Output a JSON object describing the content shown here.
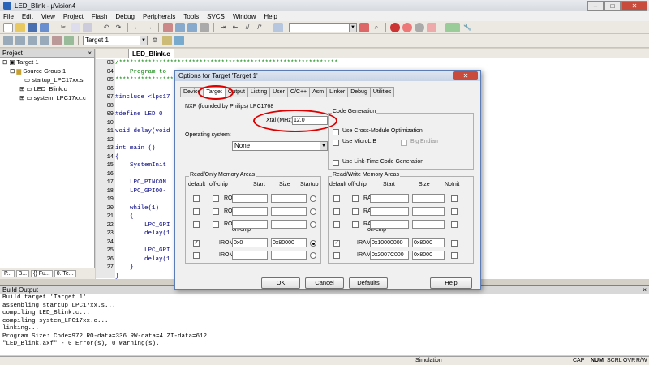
{
  "window": {
    "title": "LED_Blink - µVision4",
    "min": "–",
    "max": "□",
    "close": "✕"
  },
  "menu": [
    "File",
    "Edit",
    "View",
    "Project",
    "Flash",
    "Debug",
    "Peripherals",
    "Tools",
    "SVCS",
    "Window",
    "Help"
  ],
  "toolbar": {
    "target_select": "Target 1"
  },
  "project": {
    "header": "Project",
    "tree": [
      "Target 1",
      "Source Group 1",
      "startup_LPC17xx.s",
      "LED_Blink.c",
      "system_LPC17xx.c"
    ],
    "tabs": [
      "P...",
      "B...",
      "{} Fu...",
      "0. Te..."
    ]
  },
  "editor": {
    "tab": "LED_Blink.c",
    "line_numbers": [
      "03",
      "04",
      "05",
      "06",
      "07",
      "08",
      "09",
      "10",
      "11",
      "12",
      "13",
      "14",
      "15",
      "16",
      "17",
      "18",
      "19",
      "20",
      "21",
      "22",
      "23",
      "24",
      "25",
      "26",
      "27"
    ],
    "lines": [
      "/************************************************************",
      "    Program to",
      "*************************************************************",
      "",
      "#include <lpc17",
      "",
      "#define LED 0",
      "",
      "void delay(void",
      "",
      "int main ()",
      "{",
      "    SystemInit",
      "",
      "    LPC_PINCON",
      "    LPC_GPIO0-",
      "",
      "    while(1)",
      "    {",
      "        LPC_GPI",
      "        delay(1",
      "",
      "        LPC_GPI",
      "        delay(1",
      "    }",
      "}"
    ]
  },
  "build": {
    "header": "Build Output",
    "lines": [
      "Build target 'Target 1'",
      "assembling startup_LPC17xx.s...",
      "compiling LED_Blink.c...",
      "compiling system_LPC17xx.c...",
      "linking...",
      "Program Size: Code=972 RO-data=336 RW-data=4 ZI-data=612",
      "\"LED_Blink.axf\" - 0 Error(s), 0 Warning(s)."
    ]
  },
  "status": {
    "mode": "Simulation",
    "caps": "CAP",
    "num": "NUM",
    "scrl": "SCRL",
    "ovr": "OVR",
    "rw": "R/W"
  },
  "dialog": {
    "title": "Options for Target 'Target 1'",
    "tabs": [
      "Device",
      "Target",
      "Output",
      "Listing",
      "User",
      "C/C++",
      "Asm",
      "Linker",
      "Debug",
      "Utilities"
    ],
    "device": "NXP (founded by Philips) LPC1768",
    "xtal_label": "Xtal (MHz):",
    "xtal_value": "12.0",
    "os_label": "Operating system:",
    "os_value": "None",
    "codegen": {
      "title": "Code Generation",
      "cross": "Use Cross-Module Optimization",
      "microlib": "Use MicroLIB",
      "bigendian": "Big Endian",
      "ltcg": "Use Link-Time Code Generation"
    },
    "rom": {
      "title": "Read/Only Memory Areas",
      "h_default": "default",
      "h_offchip": "off-chip",
      "h_start": "Start",
      "h_size": "Size",
      "h_startup": "Startup",
      "onchip": "on-chip",
      "rows": [
        {
          "name": "ROM1:",
          "start": "",
          "size": ""
        },
        {
          "name": "ROM2:",
          "start": "",
          "size": ""
        },
        {
          "name": "ROM3:",
          "start": "",
          "size": ""
        },
        {
          "name": "IROM1:",
          "start": "0x0",
          "size": "0x80000"
        },
        {
          "name": "IROM2:",
          "start": "",
          "size": ""
        }
      ]
    },
    "ram": {
      "title": "Read/Write Memory Areas",
      "h_default": "default",
      "h_offchip": "off-chip",
      "h_start": "Start",
      "h_size": "Size",
      "h_noinit": "NoInit",
      "onchip": "on-chip",
      "rows": [
        {
          "name": "RAM1:",
          "start": "",
          "size": ""
        },
        {
          "name": "RAM2:",
          "start": "",
          "size": ""
        },
        {
          "name": "RAM3:",
          "start": "",
          "size": ""
        },
        {
          "name": "IRAM1:",
          "start": "0x10000000",
          "size": "0x8000"
        },
        {
          "name": "IRAM2:",
          "start": "0x2007C000",
          "size": "0x8000"
        }
      ]
    },
    "buttons": {
      "ok": "OK",
      "cancel": "Cancel",
      "defaults": "Defaults",
      "help": "Help"
    }
  }
}
